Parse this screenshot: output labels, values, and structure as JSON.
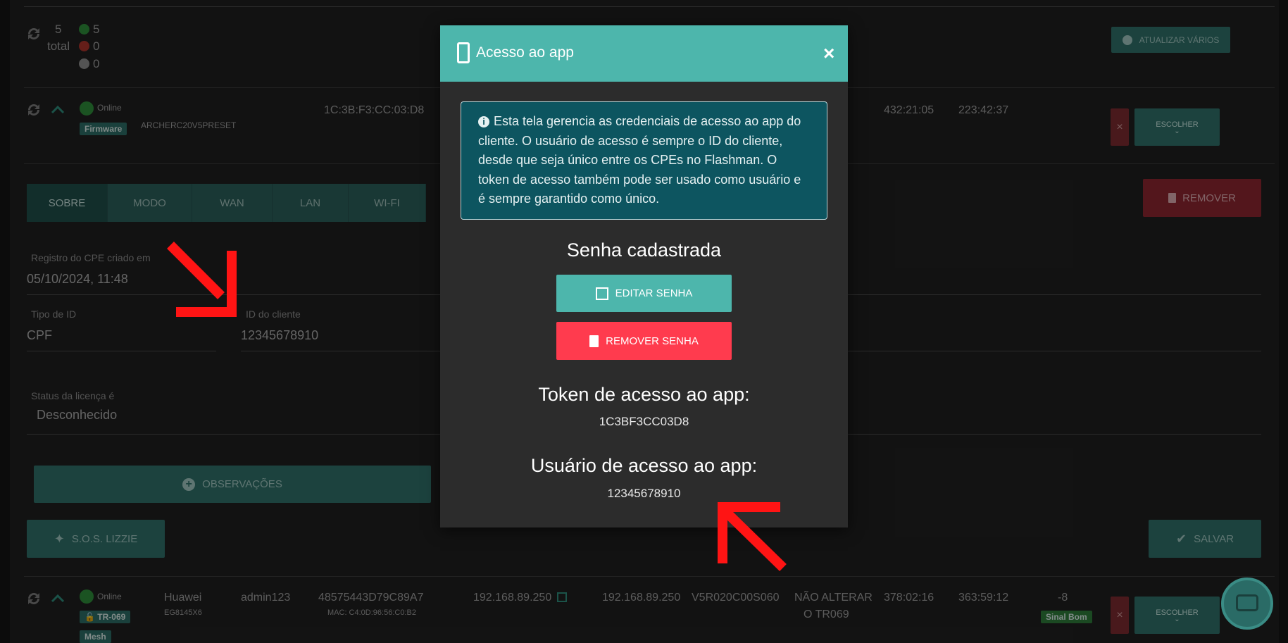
{
  "summary_row": {
    "count": "5",
    "total_label": "total",
    "online_count": "5",
    "offline_count": "0",
    "unknown_count": "0",
    "update_many_button": "ATUALIZAR VÁRIOS"
  },
  "device_row_1": {
    "status": "Online",
    "firmware_badge": "Firmware",
    "model": "ARCHERC20V5PRESET",
    "mac": "1C:3B:F3:CC:03:D8",
    "uptime_1": "432:21:05",
    "uptime_2": "223:42:37",
    "choose_button": "ESCOLHER",
    "choose_caret": "⌄",
    "close_button": "×"
  },
  "tabs": [
    "SOBRE",
    "MODO",
    "WAN",
    "LAN",
    "WI-FI"
  ],
  "remove_button": "REMOVER",
  "form": {
    "created_label": "Registro do CPE criado em",
    "created_value": "05/10/2024, 11:48",
    "id_type_label": "Tipo de ID",
    "id_type_value": "CPF",
    "client_id_label": "ID do cliente",
    "client_id_value": "12345678910",
    "license_label": "Status da licença é",
    "license_value": "Desconhecido"
  },
  "notes_button": "OBSERVAÇÕES",
  "sos_button": "S.O.S. LIZZIE",
  "save_button": "SALVAR",
  "device_row_2": {
    "status": "Online",
    "tr_badge": "TR-069",
    "mesh_badge": "Mesh",
    "vendor": "Huawei",
    "model": "EG8145X6",
    "user": "admin123",
    "serial": "48575443D79C89A7",
    "mac": "MAC: C4:0D:96:56:C0:B2",
    "wan_ip": "192.168.89.250",
    "ip": "192.168.89.250",
    "firmware": "V5R020C00S060",
    "tr069_line1": "NÃO ALTERAR",
    "tr069_line2": "O TR069",
    "uptime_1": "378:02:16",
    "uptime_2": "363:59:12",
    "signal_value": "-8",
    "signal_badge": "Sinal Bom",
    "choose_button": "ESCOLHER",
    "choose_caret": "⌄",
    "close_button": "×"
  },
  "modal": {
    "title": "Acesso ao app",
    "close": "×",
    "info_text": "Esta tela gerencia as credenciais de acesso ao app do cliente. O usuário de acesso é sempre o ID do cliente, desde que seja único entre os CPEs no Flashman. O token de acesso também pode ser usado como usuário e é sempre garantido como único.",
    "password_heading": "Senha cadastrada",
    "edit_password_button": "EDITAR SENHA",
    "remove_password_button": "REMOVER SENHA",
    "token_heading": "Token de acesso ao app:",
    "token_value": "1C3BF3CC03D8",
    "user_heading": "Usuário de acesso ao app:",
    "user_value": "12345678910"
  },
  "colors": {
    "teal": "#4db6ac",
    "info_bg": "#0d5560",
    "danger": "#ff3b4e",
    "online": "#2e9e3e",
    "offline": "#c0392b",
    "arrow": "#ff1414"
  }
}
